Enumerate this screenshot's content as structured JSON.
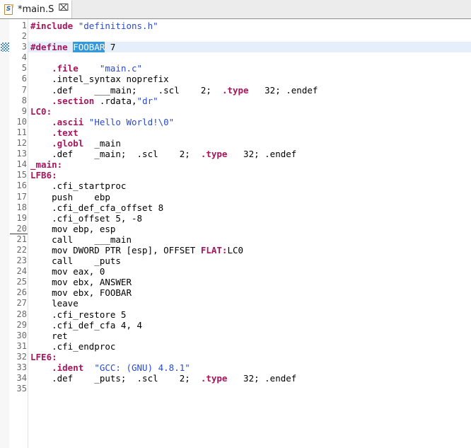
{
  "window": {
    "title": "*main.S",
    "accent_selection_color": "#3399dd",
    "current_line_color": "#e4effb",
    "directive_color": "#a8155c",
    "string_color": "#2a4ad0"
  },
  "tab_bar": {
    "tabs": [
      {
        "label": "*main.S",
        "icon": "assembly-file-icon",
        "icon_letter": "S",
        "close_glyph": "⌧",
        "active": true,
        "dirty": true
      }
    ]
  },
  "gutter": {
    "annotation_marker_line": 3,
    "annotation_marker_name": "occurrence-marker",
    "underlined_line": 20,
    "line_numbers": [
      "1",
      "2",
      "3",
      "4",
      "5",
      "6",
      "7",
      "8",
      "9",
      "10",
      "11",
      "12",
      "13",
      "14",
      "15",
      "16",
      "17",
      "18",
      "19",
      "20",
      "21",
      "22",
      "23",
      "24",
      "25",
      "26",
      "27",
      "28",
      "29",
      "30",
      "31",
      "32",
      "33",
      "34",
      "35"
    ]
  },
  "editor": {
    "selected_token": "FOOBAR",
    "current_line": 3,
    "lines": [
      {
        "n": 1,
        "tokens": [
          {
            "t": "#include",
            "c": "preproc"
          },
          {
            "t": " ",
            "c": "plain"
          },
          {
            "t": "\"definitions.h\"",
            "c": "string"
          }
        ]
      },
      {
        "n": 2,
        "tokens": [
          {
            "t": "",
            "c": "plain"
          }
        ]
      },
      {
        "n": 3,
        "current": true,
        "tokens": [
          {
            "t": "#define",
            "c": "preproc"
          },
          {
            "t": " ",
            "c": "plain"
          },
          {
            "t": "FOOBAR",
            "c": "selected"
          },
          {
            "t": " 7",
            "c": "plain"
          }
        ]
      },
      {
        "n": 4,
        "tokens": [
          {
            "t": "",
            "c": "plain"
          }
        ]
      },
      {
        "n": 5,
        "tokens": [
          {
            "t": "    ",
            "c": "plain"
          },
          {
            "t": ".file",
            "c": "directive"
          },
          {
            "t": "    ",
            "c": "plain"
          },
          {
            "t": "\"main.c\"",
            "c": "string"
          }
        ]
      },
      {
        "n": 6,
        "tokens": [
          {
            "t": "    ",
            "c": "plain"
          },
          {
            "t": ".intel_syntax noprefix",
            "c": "plain"
          }
        ]
      },
      {
        "n": 7,
        "tokens": [
          {
            "t": "    .def    ___main;    .scl    2;  ",
            "c": "plain"
          },
          {
            "t": ".type",
            "c": "directive"
          },
          {
            "t": "   32; .endef",
            "c": "plain"
          }
        ]
      },
      {
        "n": 8,
        "tokens": [
          {
            "t": "    ",
            "c": "plain"
          },
          {
            "t": ".section",
            "c": "directive"
          },
          {
            "t": " .rdata,",
            "c": "plain"
          },
          {
            "t": "\"dr\"",
            "c": "string"
          }
        ]
      },
      {
        "n": 9,
        "tokens": [
          {
            "t": "LC0:",
            "c": "label"
          }
        ]
      },
      {
        "n": 10,
        "tokens": [
          {
            "t": "    ",
            "c": "plain"
          },
          {
            "t": ".ascii",
            "c": "directive"
          },
          {
            "t": " ",
            "c": "plain"
          },
          {
            "t": "\"Hello World!\\0\"",
            "c": "string"
          }
        ]
      },
      {
        "n": 11,
        "tokens": [
          {
            "t": "    ",
            "c": "plain"
          },
          {
            "t": ".text",
            "c": "directive"
          }
        ]
      },
      {
        "n": 12,
        "tokens": [
          {
            "t": "    ",
            "c": "plain"
          },
          {
            "t": ".globl",
            "c": "directive"
          },
          {
            "t": "  _main",
            "c": "plain"
          }
        ]
      },
      {
        "n": 13,
        "tokens": [
          {
            "t": "    .def    _main;  .scl    2;  ",
            "c": "plain"
          },
          {
            "t": ".type",
            "c": "directive"
          },
          {
            "t": "   32; .endef",
            "c": "plain"
          }
        ]
      },
      {
        "n": 14,
        "tokens": [
          {
            "t": "_main:",
            "c": "label"
          }
        ]
      },
      {
        "n": 15,
        "tokens": [
          {
            "t": "LFB6:",
            "c": "label"
          }
        ]
      },
      {
        "n": 16,
        "tokens": [
          {
            "t": "    .cfi_startproc",
            "c": "plain"
          }
        ]
      },
      {
        "n": 17,
        "tokens": [
          {
            "t": "    push    ebp",
            "c": "plain"
          }
        ]
      },
      {
        "n": 18,
        "tokens": [
          {
            "t": "    .cfi_def_cfa_offset 8",
            "c": "plain"
          }
        ]
      },
      {
        "n": 19,
        "tokens": [
          {
            "t": "    .cfi_offset 5, -8",
            "c": "plain"
          }
        ]
      },
      {
        "n": 20,
        "tokens": [
          {
            "t": "    mov ebp, esp",
            "c": "plain"
          }
        ]
      },
      {
        "n": 21,
        "tokens": [
          {
            "t": "    call    ___main",
            "c": "plain"
          }
        ]
      },
      {
        "n": 22,
        "tokens": [
          {
            "t": "    mov DWORD PTR [esp], OFFSET ",
            "c": "plain"
          },
          {
            "t": "FLAT:",
            "c": "label"
          },
          {
            "t": "LC0",
            "c": "plain"
          }
        ]
      },
      {
        "n": 23,
        "tokens": [
          {
            "t": "    call    _puts",
            "c": "plain"
          }
        ]
      },
      {
        "n": 24,
        "tokens": [
          {
            "t": "    mov eax, 0",
            "c": "plain"
          }
        ]
      },
      {
        "n": 25,
        "tokens": [
          {
            "t": "    mov ebx, ANSWER",
            "c": "plain"
          }
        ]
      },
      {
        "n": 26,
        "tokens": [
          {
            "t": "    mov ebx, FOOBAR",
            "c": "plain"
          }
        ]
      },
      {
        "n": 27,
        "tokens": [
          {
            "t": "    leave",
            "c": "plain"
          }
        ]
      },
      {
        "n": 28,
        "tokens": [
          {
            "t": "    .cfi_restore 5",
            "c": "plain"
          }
        ]
      },
      {
        "n": 29,
        "tokens": [
          {
            "t": "    .cfi_def_cfa 4, 4",
            "c": "plain"
          }
        ]
      },
      {
        "n": 30,
        "tokens": [
          {
            "t": "    ret",
            "c": "plain"
          }
        ]
      },
      {
        "n": 31,
        "tokens": [
          {
            "t": "    .cfi_endproc",
            "c": "plain"
          }
        ]
      },
      {
        "n": 32,
        "tokens": [
          {
            "t": "LFE6:",
            "c": "label"
          }
        ]
      },
      {
        "n": 33,
        "tokens": [
          {
            "t": "    ",
            "c": "plain"
          },
          {
            "t": ".ident",
            "c": "directive"
          },
          {
            "t": "  ",
            "c": "plain"
          },
          {
            "t": "\"GCC: (GNU) 4.8.1\"",
            "c": "string"
          }
        ]
      },
      {
        "n": 34,
        "tokens": [
          {
            "t": "    .def    _puts;  .scl    2;  ",
            "c": "plain"
          },
          {
            "t": ".type",
            "c": "directive"
          },
          {
            "t": "   32; .endef",
            "c": "plain"
          }
        ]
      },
      {
        "n": 35,
        "tokens": [
          {
            "t": "",
            "c": "plain"
          }
        ]
      }
    ]
  }
}
